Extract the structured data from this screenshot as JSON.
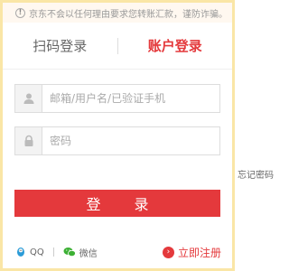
{
  "notice": {
    "icon": "info-icon",
    "text": "京东不会以任何理由要求您转账汇款，谨防诈骗。"
  },
  "tabs": [
    {
      "label": "扫码登录",
      "active": false
    },
    {
      "label": "账户登录",
      "active": true
    }
  ],
  "form": {
    "username_placeholder": "邮箱/用户名/已验证手机",
    "username_value": "",
    "password_placeholder": "密码",
    "password_value": "",
    "forgot_label": "忘记密码",
    "login_label": "登 录"
  },
  "footer": {
    "qq_label": "QQ",
    "wechat_label": "微信",
    "register_label": "立即注册"
  },
  "colors": {
    "accent": "#e4393c",
    "frame": "#fae6a6"
  }
}
